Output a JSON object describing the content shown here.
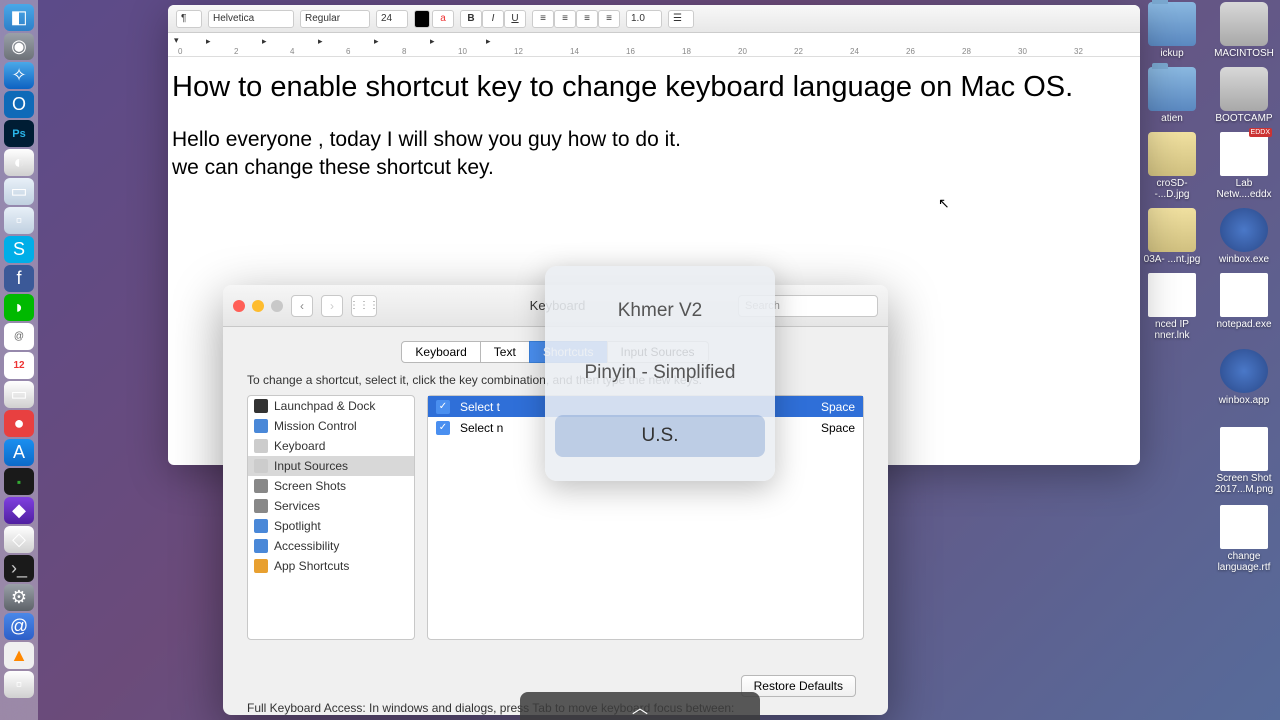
{
  "dock": {
    "items": [
      "finder",
      "dashboard",
      "safari",
      "outlook",
      "photoshop",
      "disk",
      "trash",
      "finder2",
      "skype",
      "facebook",
      "line",
      "appstore",
      "calendar",
      "notes",
      "reminders",
      "appstore2",
      "activity",
      "purple",
      "unity",
      "terminal",
      "settings",
      "mail",
      "vlc",
      "app24"
    ]
  },
  "desktop": {
    "icons": [
      {
        "label": "ickup",
        "type": "folder"
      },
      {
        "label": "MACINTOSH",
        "type": "hd"
      },
      {
        "label": "atien",
        "type": "folder"
      },
      {
        "label": "BOOTCAMP",
        "type": "hd"
      },
      {
        "label": "croSD-\n-...D.jpg",
        "type": "img"
      },
      {
        "label": "Lab\nNetw....eddx",
        "type": "file",
        "badge": "EDDX"
      },
      {
        "label": "03A-\n...nt.jpg",
        "type": "img"
      },
      {
        "label": "winbox.exe",
        "type": "winbox"
      },
      {
        "label": "nced IP\nnner.lnk",
        "type": "file"
      },
      {
        "label": "notepad.exe",
        "type": "file"
      },
      {
        "label": "",
        "type": "blank"
      },
      {
        "label": "winbox.app",
        "type": "winbox"
      },
      {
        "label": "",
        "type": "blank"
      },
      {
        "label": "Screen Shot\n2017...M.png",
        "type": "file"
      },
      {
        "label": "",
        "type": "blank"
      },
      {
        "label": "change\nlanguage.rtf",
        "type": "file"
      }
    ]
  },
  "textedit": {
    "toolbar": {
      "style": "¶",
      "font": "Helvetica",
      "weight": "Regular",
      "size": "24",
      "color": "#000",
      "spacing": "1.0"
    },
    "content": {
      "title": "How to enable shortcut key to change keyboard language on Mac OS.",
      "p1": "Hello everyone , today I will show you guy how to do it.",
      "p2": "we can change these shortcut key."
    },
    "ruler_numbers": [
      "0",
      "2",
      "4",
      "6",
      "8",
      "10",
      "12",
      "14",
      "16",
      "18",
      "20",
      "22",
      "24",
      "26",
      "28",
      "30",
      "32"
    ]
  },
  "sysprefs": {
    "title": "Keyboard",
    "search_placeholder": "Search",
    "tabs": [
      "Keyboard",
      "Text",
      "Shortcuts",
      "Input Sources"
    ],
    "active_tab": 2,
    "instruction": "To change a shortcut, select it, click the key combination, and then type the new keys.",
    "categories": [
      {
        "label": "Launchpad & Dock",
        "icon": "#333"
      },
      {
        "label": "Mission Control",
        "icon": "#4a88d8"
      },
      {
        "label": "Keyboard",
        "icon": "#ccc"
      },
      {
        "label": "Input Sources",
        "icon": "#ccc",
        "selected": true
      },
      {
        "label": "Screen Shots",
        "icon": "#888"
      },
      {
        "label": "Services",
        "icon": "#888"
      },
      {
        "label": "Spotlight",
        "icon": "#4a88d8"
      },
      {
        "label": "Accessibility",
        "icon": "#4a88d8"
      },
      {
        "label": "App Shortcuts",
        "icon": "#e8a030"
      }
    ],
    "shortcuts": [
      {
        "label": "Select the previous input source",
        "key": "⌘Space",
        "checked": true,
        "highlighted": true
      },
      {
        "label": "Select next source in Input menu",
        "key": "⌥⌘Space",
        "checked": true,
        "highlighted": false
      }
    ],
    "restore": "Restore Defaults",
    "footer": "Full Keyboard Access: In windows and dialogs, press Tab to move keyboard focus between:"
  },
  "switcher": {
    "items": [
      "Khmer V2",
      "Pinyin - Simplified",
      "U.S."
    ],
    "selected": 2
  }
}
